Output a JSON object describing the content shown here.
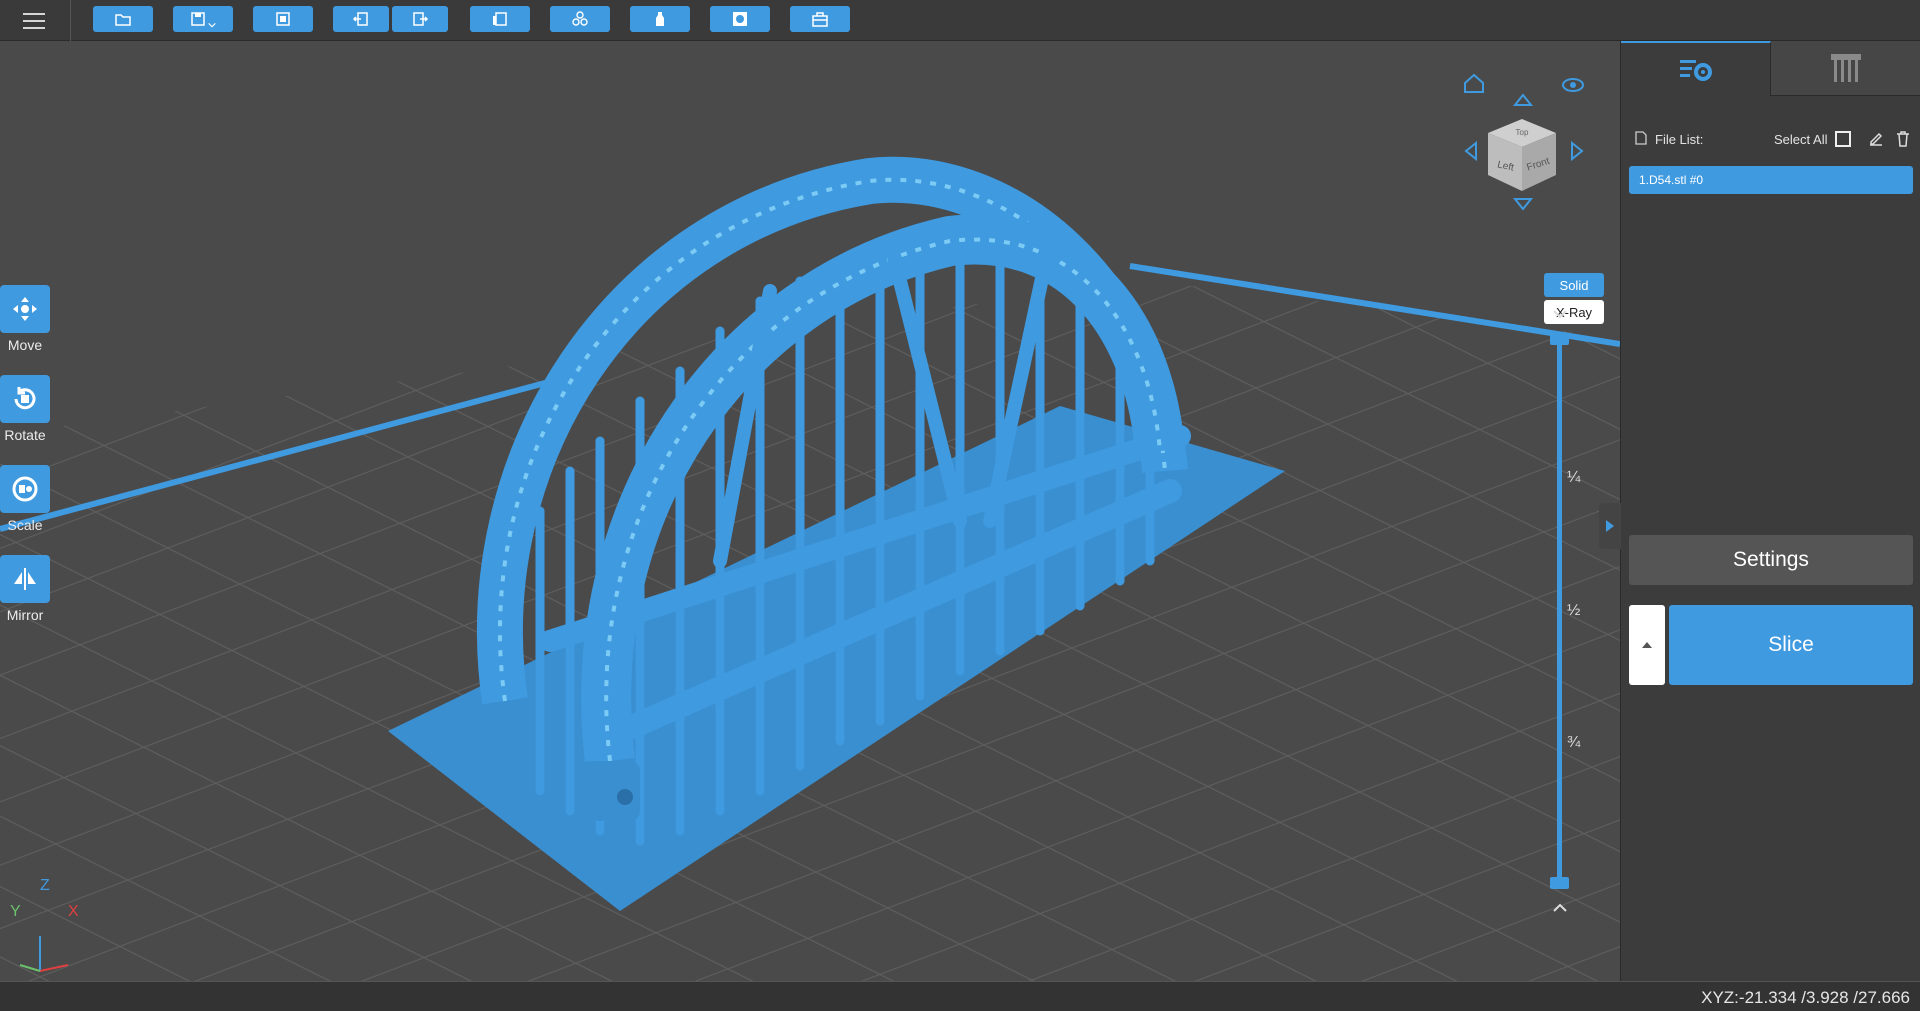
{
  "toolbar": {
    "items": [
      "open-file",
      "save",
      "fit-view",
      "undo",
      "redo",
      "layout",
      "arrange",
      "hollow",
      "punch-hole",
      "repair"
    ]
  },
  "left_tools": [
    {
      "id": "move",
      "label": "Move"
    },
    {
      "id": "rotate",
      "label": "Rotate"
    },
    {
      "id": "scale",
      "label": "Scale"
    },
    {
      "id": "mirror",
      "label": "Mirror"
    }
  ],
  "view_cube": {
    "left_face": "Left",
    "front_face": "Front",
    "top_face": "Top"
  },
  "view_modes": {
    "solid": "Solid",
    "xray": "X-Ray",
    "active": "Solid"
  },
  "layer_slider": {
    "marks": [
      "¼",
      "½",
      "¾"
    ],
    "top_value": 1.0,
    "bottom_value": 0.0
  },
  "axes": {
    "x": "X",
    "y": "Y",
    "z": "Z"
  },
  "panel": {
    "file_list_label": "File List:",
    "select_all_label": "Select All",
    "files": [
      "1.D54.stl #0"
    ],
    "settings_label": "Settings",
    "slice_label": "Slice"
  },
  "status": {
    "coords": "XYZ:-21.334 /3.928 /27.666"
  },
  "colors": {
    "accent": "#3f9ae0",
    "background": "#4b4b4b",
    "model": "#3f9ae0"
  }
}
